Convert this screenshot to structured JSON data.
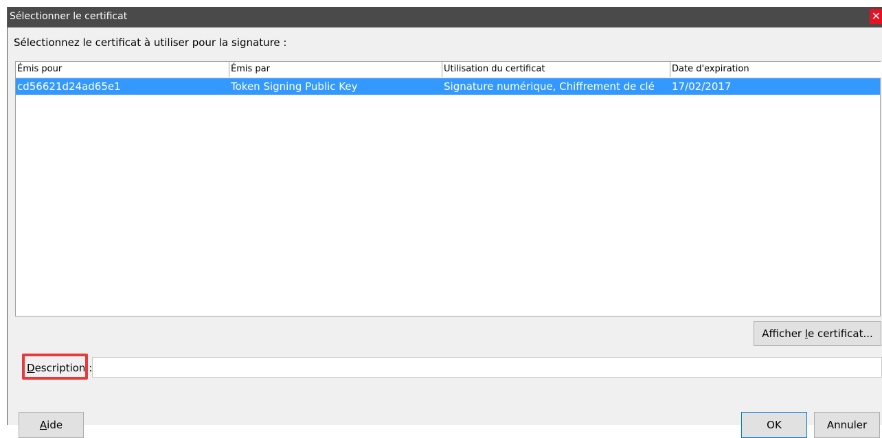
{
  "window": {
    "title": "Sélectionner le certificat",
    "close_glyph": "✕"
  },
  "prompt": "Sélectionnez le certificat à utiliser pour la signature :",
  "table": {
    "columns": [
      "Émis pour",
      "Émis par",
      "Utilisation du certificat",
      "Date d'expiration"
    ],
    "rows": [
      {
        "issued_to": "cd56621d24ad65e1",
        "issued_by": "Token Signing Public Key",
        "usage": "Signature numérique, Chiffrement de clé",
        "expiration": "17/02/2017",
        "selected": true
      }
    ]
  },
  "buttons": {
    "view_certificate": {
      "pre": "Afficher ",
      "accel": "l",
      "post": "e certificat..."
    },
    "help": {
      "accel": "A",
      "post": "ide"
    },
    "ok": "OK",
    "cancel": "Annuler"
  },
  "description": {
    "label_accel": "D",
    "label_rest": "escription :",
    "value": ""
  },
  "colors": {
    "selection": "#3399ff",
    "highlight_box": "#e83a3a",
    "titlebar": "#4a4a4a",
    "close": "#e81123"
  }
}
